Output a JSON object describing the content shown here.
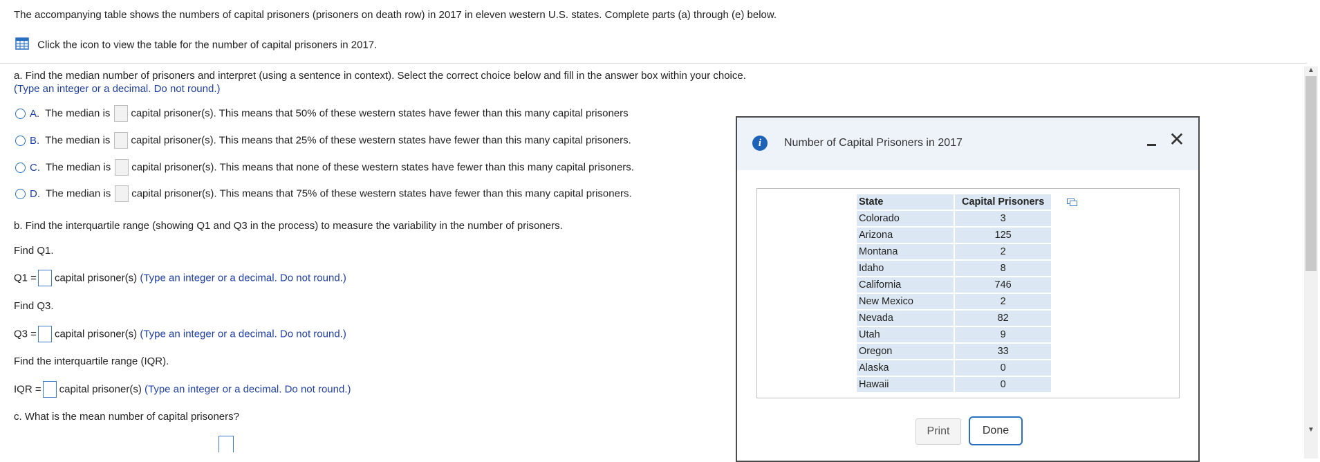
{
  "intro": "The accompanying table shows the numbers of capital prisoners (prisoners on death row) in 2017 in eleven western U.S. states. Complete parts (a) through (e) below.",
  "table_link": "Click the icon to view the table for the number of capital prisoners in 2017.",
  "part_a": {
    "prompt": "a. Find the median number of prisoners and interpret (using a sentence in context). Select the correct choice below and fill in the answer box within your choice.",
    "hint": "(Type an integer or a decimal. Do not round.)",
    "choices": [
      {
        "letter": "A.",
        "before": "The median is",
        "after": "capital prisoner(s). This means that 50% of these western states have fewer than this many capital prisoners"
      },
      {
        "letter": "B.",
        "before": "The median is",
        "after": "capital prisoner(s). This means that 25% of these western states have fewer than this many capital prisoners."
      },
      {
        "letter": "C.",
        "before": "The median is",
        "after": "capital prisoner(s). This means that none of these western states have fewer than this many capital prisoners."
      },
      {
        "letter": "D.",
        "before": "The median is",
        "after": "capital prisoner(s). This means that 75% of these western states have fewer than this many capital prisoners."
      }
    ]
  },
  "part_b": {
    "prompt": "b. Find the interquartile range (showing Q1 and Q3 in the process) to measure the variability in the number of prisoners.",
    "find_q1": "Find Q1.",
    "q1_label": "Q1 =",
    "find_q3": "Find Q3.",
    "q3_label": "Q3 =",
    "find_iqr": "Find the interquartile range (IQR).",
    "iqr_label": "IQR =",
    "unit": "capital prisoner(s)",
    "hint": "(Type an integer or a decimal. Do not round.)"
  },
  "part_c": {
    "prompt": "c. What is the mean number of capital prisoners?"
  },
  "modal": {
    "title": "Number of Capital Prisoners in 2017",
    "columns": [
      "State",
      "Capital Prisoners"
    ],
    "rows": [
      [
        "Colorado",
        "3"
      ],
      [
        "Arizona",
        "125"
      ],
      [
        "Montana",
        "2"
      ],
      [
        "Idaho",
        "8"
      ],
      [
        "California",
        "746"
      ],
      [
        "New Mexico",
        "2"
      ],
      [
        "Nevada",
        "82"
      ],
      [
        "Utah",
        "9"
      ],
      [
        "Oregon",
        "33"
      ],
      [
        "Alaska",
        "0"
      ],
      [
        "Hawaii",
        "0"
      ]
    ],
    "print_label": "Print",
    "done_label": "Done"
  },
  "icons": {
    "table": "table-grid-icon",
    "info": "info-icon",
    "minimize": "minimize-icon",
    "close": "close-icon",
    "copy": "copy-icon"
  },
  "colors": {
    "accent": "#2a6fbe",
    "hint_text": "#1f3fa3",
    "table_cell": "#dbe8f3",
    "modal_header": "#eef3fa"
  }
}
